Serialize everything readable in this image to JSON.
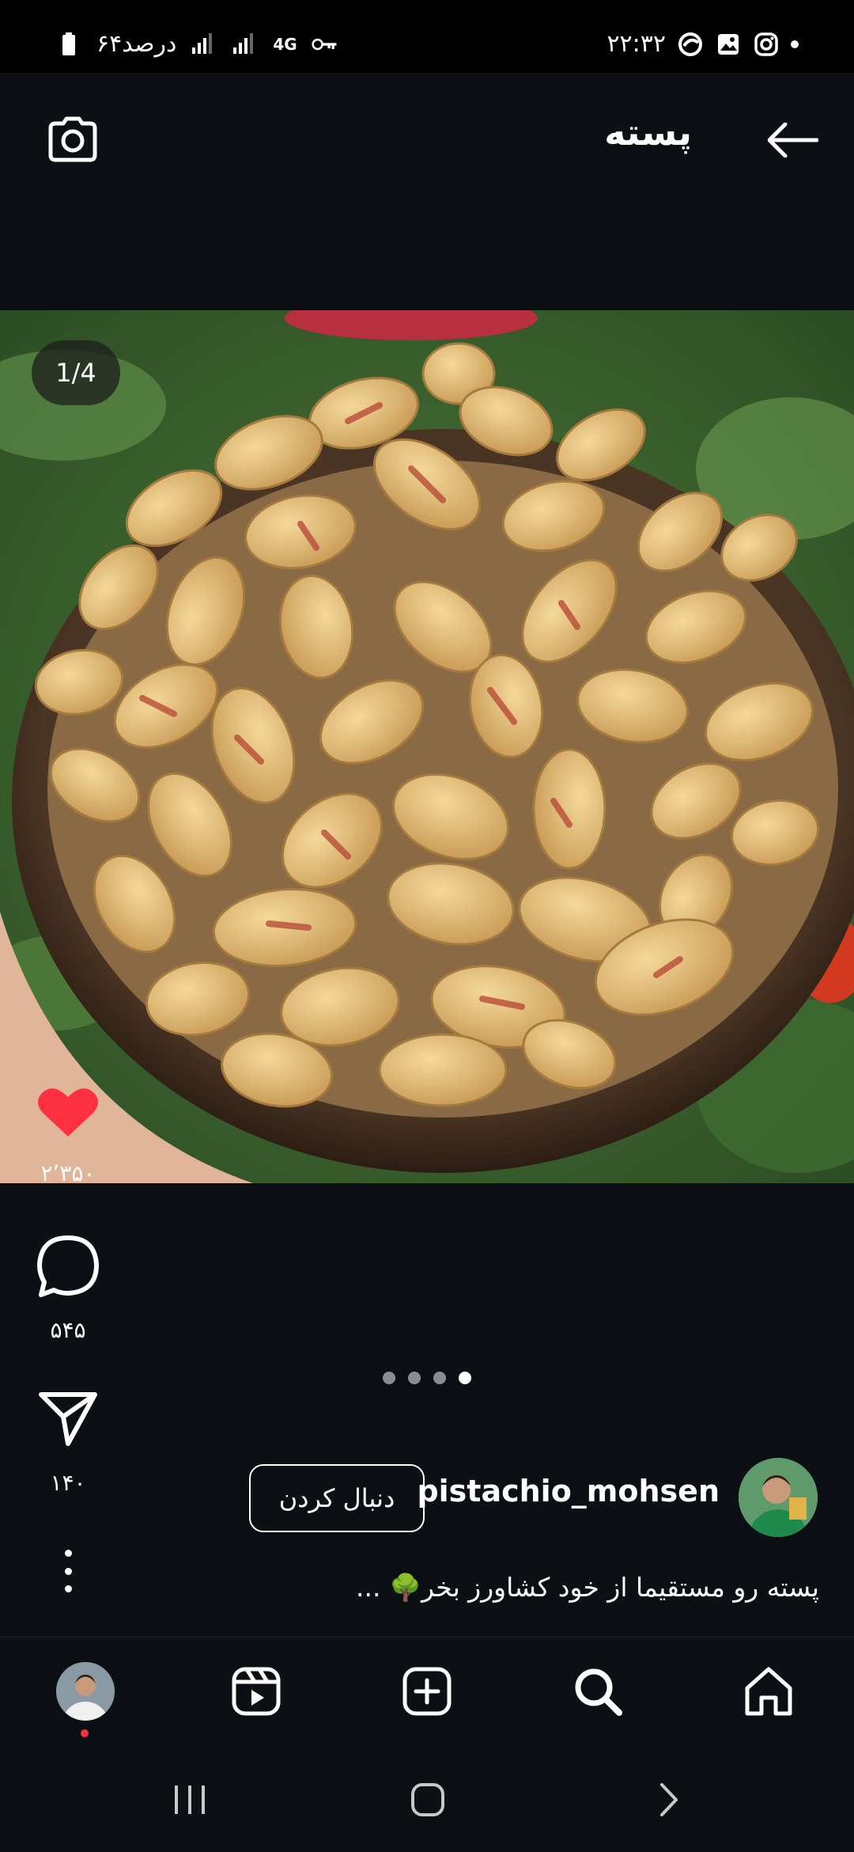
{
  "status_bar": {
    "time": "۲۲:۳۲",
    "battery_text": "۶۴درصد",
    "network": "4G",
    "icons": [
      "instagram-icon",
      "gallery-icon",
      "edge-browser-icon",
      "key-icon",
      "signal-icon",
      "battery-icon"
    ]
  },
  "header": {
    "title": "پسته",
    "back_icon": "arrow-left-icon",
    "camera_icon": "camera-icon"
  },
  "media": {
    "counter": "1/4",
    "description_icon": "pistachio-bowl-image"
  },
  "actions": {
    "like_count": "۲٬۳۵۰",
    "comment_count": "۵۴۵",
    "share_count": "۱۴۰",
    "liked": true,
    "like_color": "#ff3040"
  },
  "carousel": {
    "total": 4,
    "active_index": 4
  },
  "post": {
    "username": "pistachio_mohsen",
    "follow_label": "دنبال کردن",
    "caption": "پسته رو مستقیما از خود کشاورز بخر🌳 ..."
  },
  "bottom_nav": {
    "items": [
      "profile",
      "reels-icon",
      "create-icon",
      "search-icon",
      "home-icon"
    ]
  },
  "colors": {
    "background": "#0c0f14",
    "accent_red": "#ff3040"
  }
}
